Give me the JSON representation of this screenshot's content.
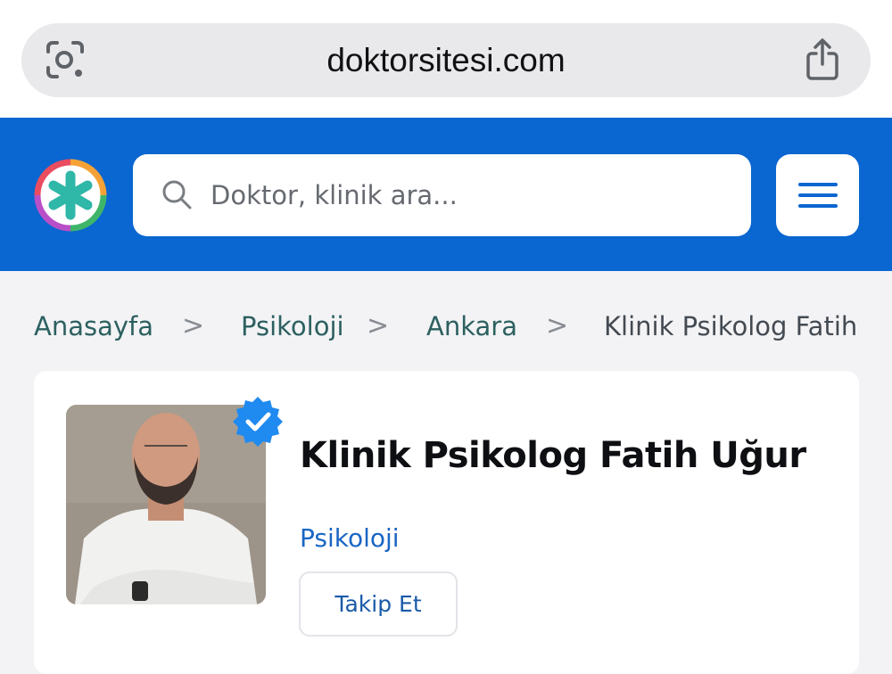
{
  "browser": {
    "url": "doktorsitesi.com"
  },
  "header": {
    "search_placeholder": "Doktor, klinik ara..."
  },
  "breadcrumb": {
    "items": [
      "Anasayfa",
      "Psikoloji",
      "Ankara",
      "Klinik Psikolog Fatih"
    ],
    "separator": ">"
  },
  "profile": {
    "name": "Klinik Psikolog Fatih Uğur",
    "specialty": "Psikoloji",
    "follow_label": "Takip Et",
    "verified": true
  },
  "colors": {
    "brand_blue": "#0a66d0",
    "breadcrumb_teal": "#2d6060",
    "specialty_blue": "#1a66c4",
    "verified_blue": "#1f8af0"
  },
  "icons": [
    "camera-lens-icon",
    "share-icon",
    "logo-asterisk-icon",
    "search-icon",
    "menu-icon",
    "verified-icon"
  ]
}
